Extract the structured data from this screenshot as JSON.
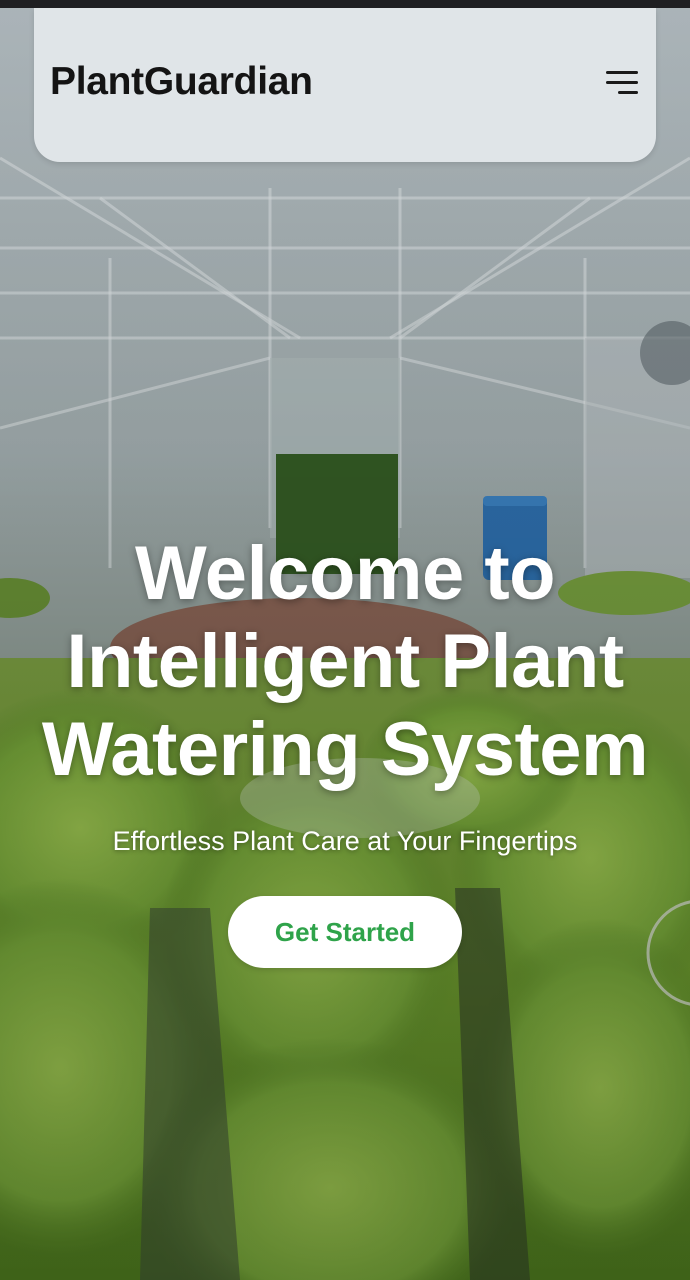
{
  "header": {
    "brand": "PlantGuardian",
    "menu_icon": "hamburger-menu-icon"
  },
  "hero": {
    "title_lines": [
      "Welcome to",
      "Intelligent Plant",
      "Watering System"
    ],
    "subtitle": "Effortless Plant Care at Your Fingertips",
    "cta_label": "Get Started"
  },
  "colors": {
    "accent": "#2fa34a",
    "header_bg": "#e2e6e9",
    "text_light": "#ffffff"
  }
}
